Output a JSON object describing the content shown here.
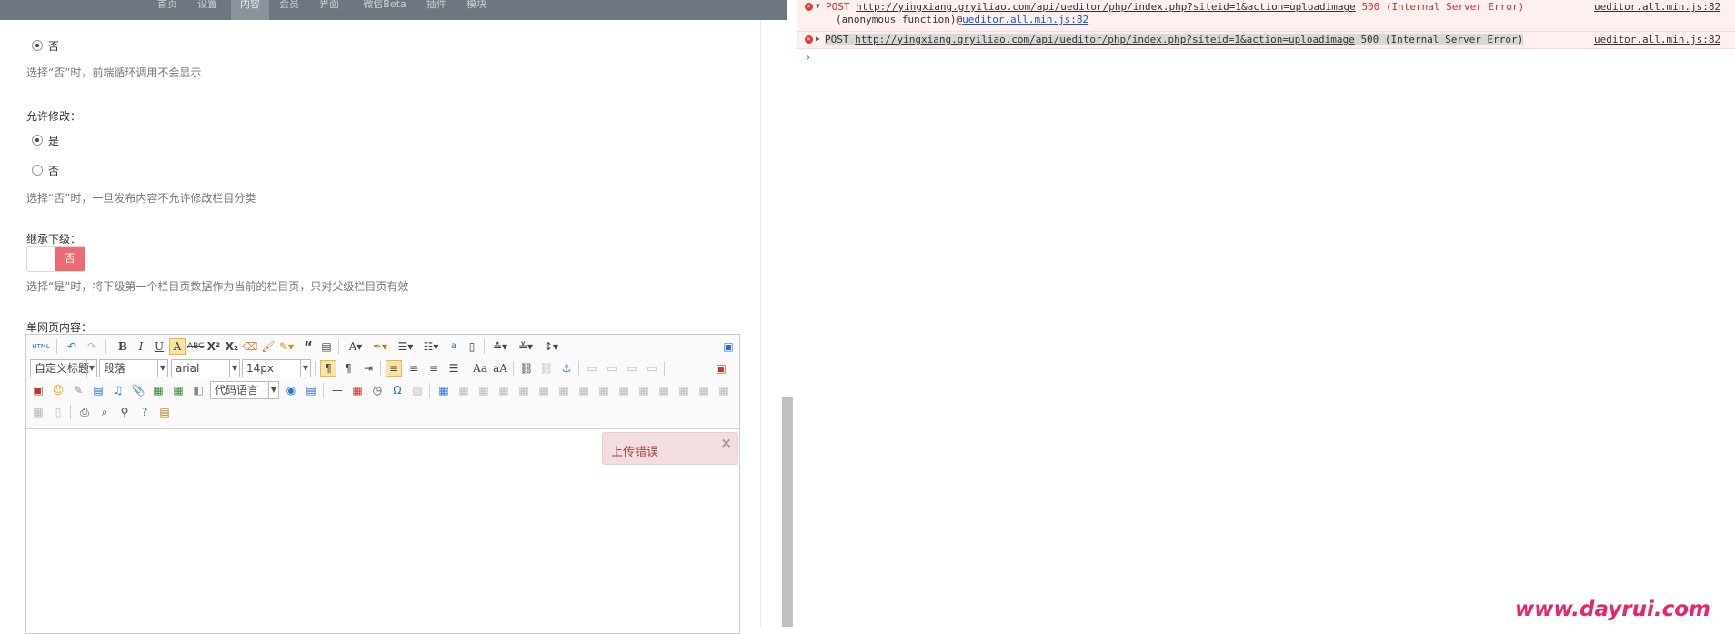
{
  "nav": {
    "items": [
      "首页",
      "设置",
      "内容",
      "会员",
      "界面",
      "微信Beta",
      "插件",
      "模块"
    ],
    "active_index": 2
  },
  "form": {
    "radio_no_top": "否",
    "hint_loop": "选择“否”时，前端循环调用不会显示",
    "allow_edit_label": "允许修改：",
    "allow_edit_yes": "是",
    "allow_edit_no": "否",
    "hint_edit": "选择“否”时，一旦发布内容不允许修改栏目分类",
    "inherit_label": "继承下级：",
    "inherit_switch_off": "否",
    "hint_inherit": "选择“是”时，将下级第一个栏目页数据作为当前的栏目页，只对父级栏目页有效",
    "page_content_label": "单网页内容："
  },
  "editor": {
    "html_button": "HTML",
    "custom_title_select": "自定义标题",
    "paragraph_select": "段落",
    "font_family_select": "arial",
    "font_size_select": "14px",
    "code_lang_select": "代码语言",
    "toast_message": "上传错误",
    "toast_close": "×"
  },
  "console": {
    "error1": {
      "method": "POST",
      "url": "http://yingxiang.gryiliao.com/api/ueditor/php/index.php?siteid=1&action=uploadimage",
      "status": "500 (Internal Server Error)",
      "source": "ueditor.all.min.js:82",
      "stack_fn": "(anonymous function)",
      "stack_at": "@",
      "stack_src": "ueditor.all.min.js:82"
    },
    "error2": {
      "method": "POST",
      "url": "http://yingxiang.gryiliao.com/api/ueditor/php/index.php?siteid=1&action=uploadimage",
      "status": "500 (Internal Server Error)",
      "source": "ueditor.all.min.js:82"
    },
    "prompt": "›"
  },
  "watermark": "www.dayrui.com",
  "colors": {
    "nav_bg": "#6e7780",
    "switch_off": "#ed6b75",
    "error_text": "#d32f2f",
    "watermark": "#e8256d",
    "toast_bg": "#f2dede"
  }
}
